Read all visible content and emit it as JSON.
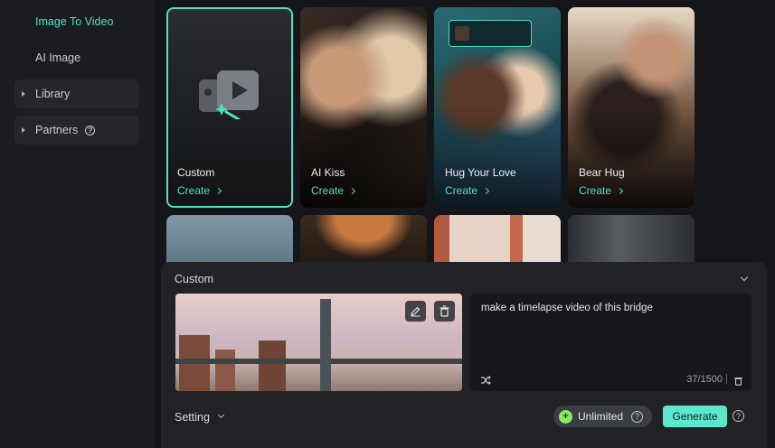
{
  "sidebar": {
    "items": [
      {
        "label": "Image To Video"
      },
      {
        "label": "AI Image"
      },
      {
        "label": "Library"
      },
      {
        "label": "Partners"
      }
    ]
  },
  "cards": [
    {
      "title": "Custom",
      "action": "Create"
    },
    {
      "title": "AI Kiss",
      "action": "Create"
    },
    {
      "title": "Hug Your Love",
      "action": "Create"
    },
    {
      "title": "Bear Hug",
      "action": "Create"
    }
  ],
  "panel": {
    "title": "Custom",
    "prompt": "make a timelapse video of this bridge",
    "counter": "37/1500",
    "setting_label": "Setting",
    "unlimited_label": "Unlimited",
    "generate_label": "Generate"
  },
  "colors": {
    "accent": "#4fe0c5",
    "generate_bg": "#5ee8cb",
    "unlimited_dot": "#8be85f"
  }
}
